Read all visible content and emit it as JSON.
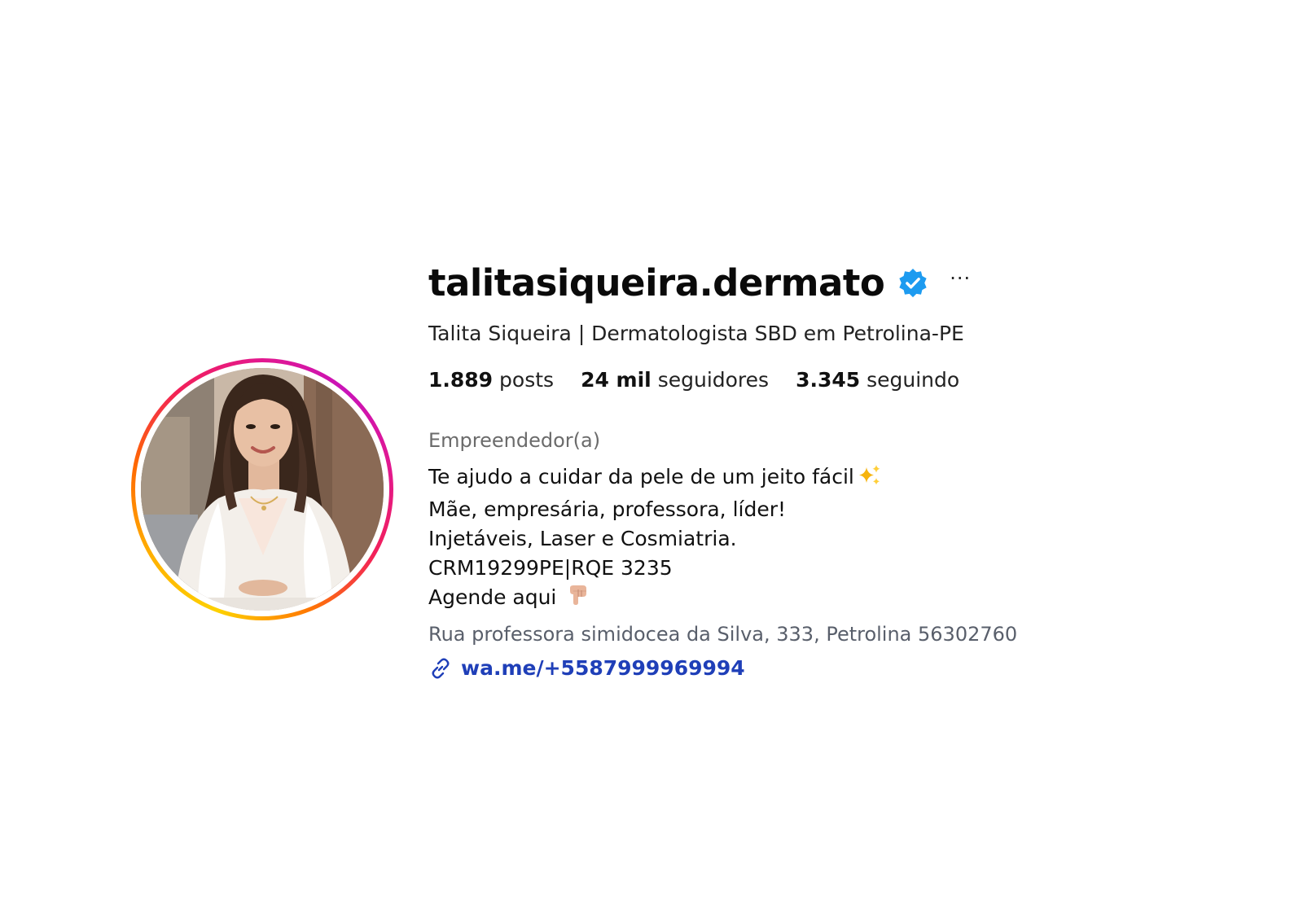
{
  "profile": {
    "username": "talitasiqueira.dermato",
    "full_name": "Talita Siqueira | Dermatologista SBD em Petrolina-PE",
    "more_label": "···",
    "avatar_icon": "profile-photo",
    "verified_icon": "verified-badge-icon"
  },
  "stats": {
    "posts_count": "1.889",
    "posts_label": "posts",
    "followers_count": "24 mil",
    "followers_label": "seguidores",
    "following_count": "3.345",
    "following_label": "seguindo"
  },
  "bio": {
    "category": "Empreendedor(a)",
    "lines": [
      "Te ajudo a cuidar da pele de um jeito fácil",
      "Mãe, empresária, professora, líder!",
      "Injetáveis, Laser e Cosmiatria.",
      "CRM19299PE|RQE 3235",
      "Agende aqui"
    ],
    "address": "Rua professora simidocea da Silva, 333, Petrolina 56302760",
    "link": "wa.me/+5587999969994"
  },
  "colors": {
    "verified": "#1d9bf0",
    "link": "#1f3fb8",
    "category": "#6b6b6b",
    "ring_start": "#fdd100",
    "ring_end": "#c913b9"
  }
}
